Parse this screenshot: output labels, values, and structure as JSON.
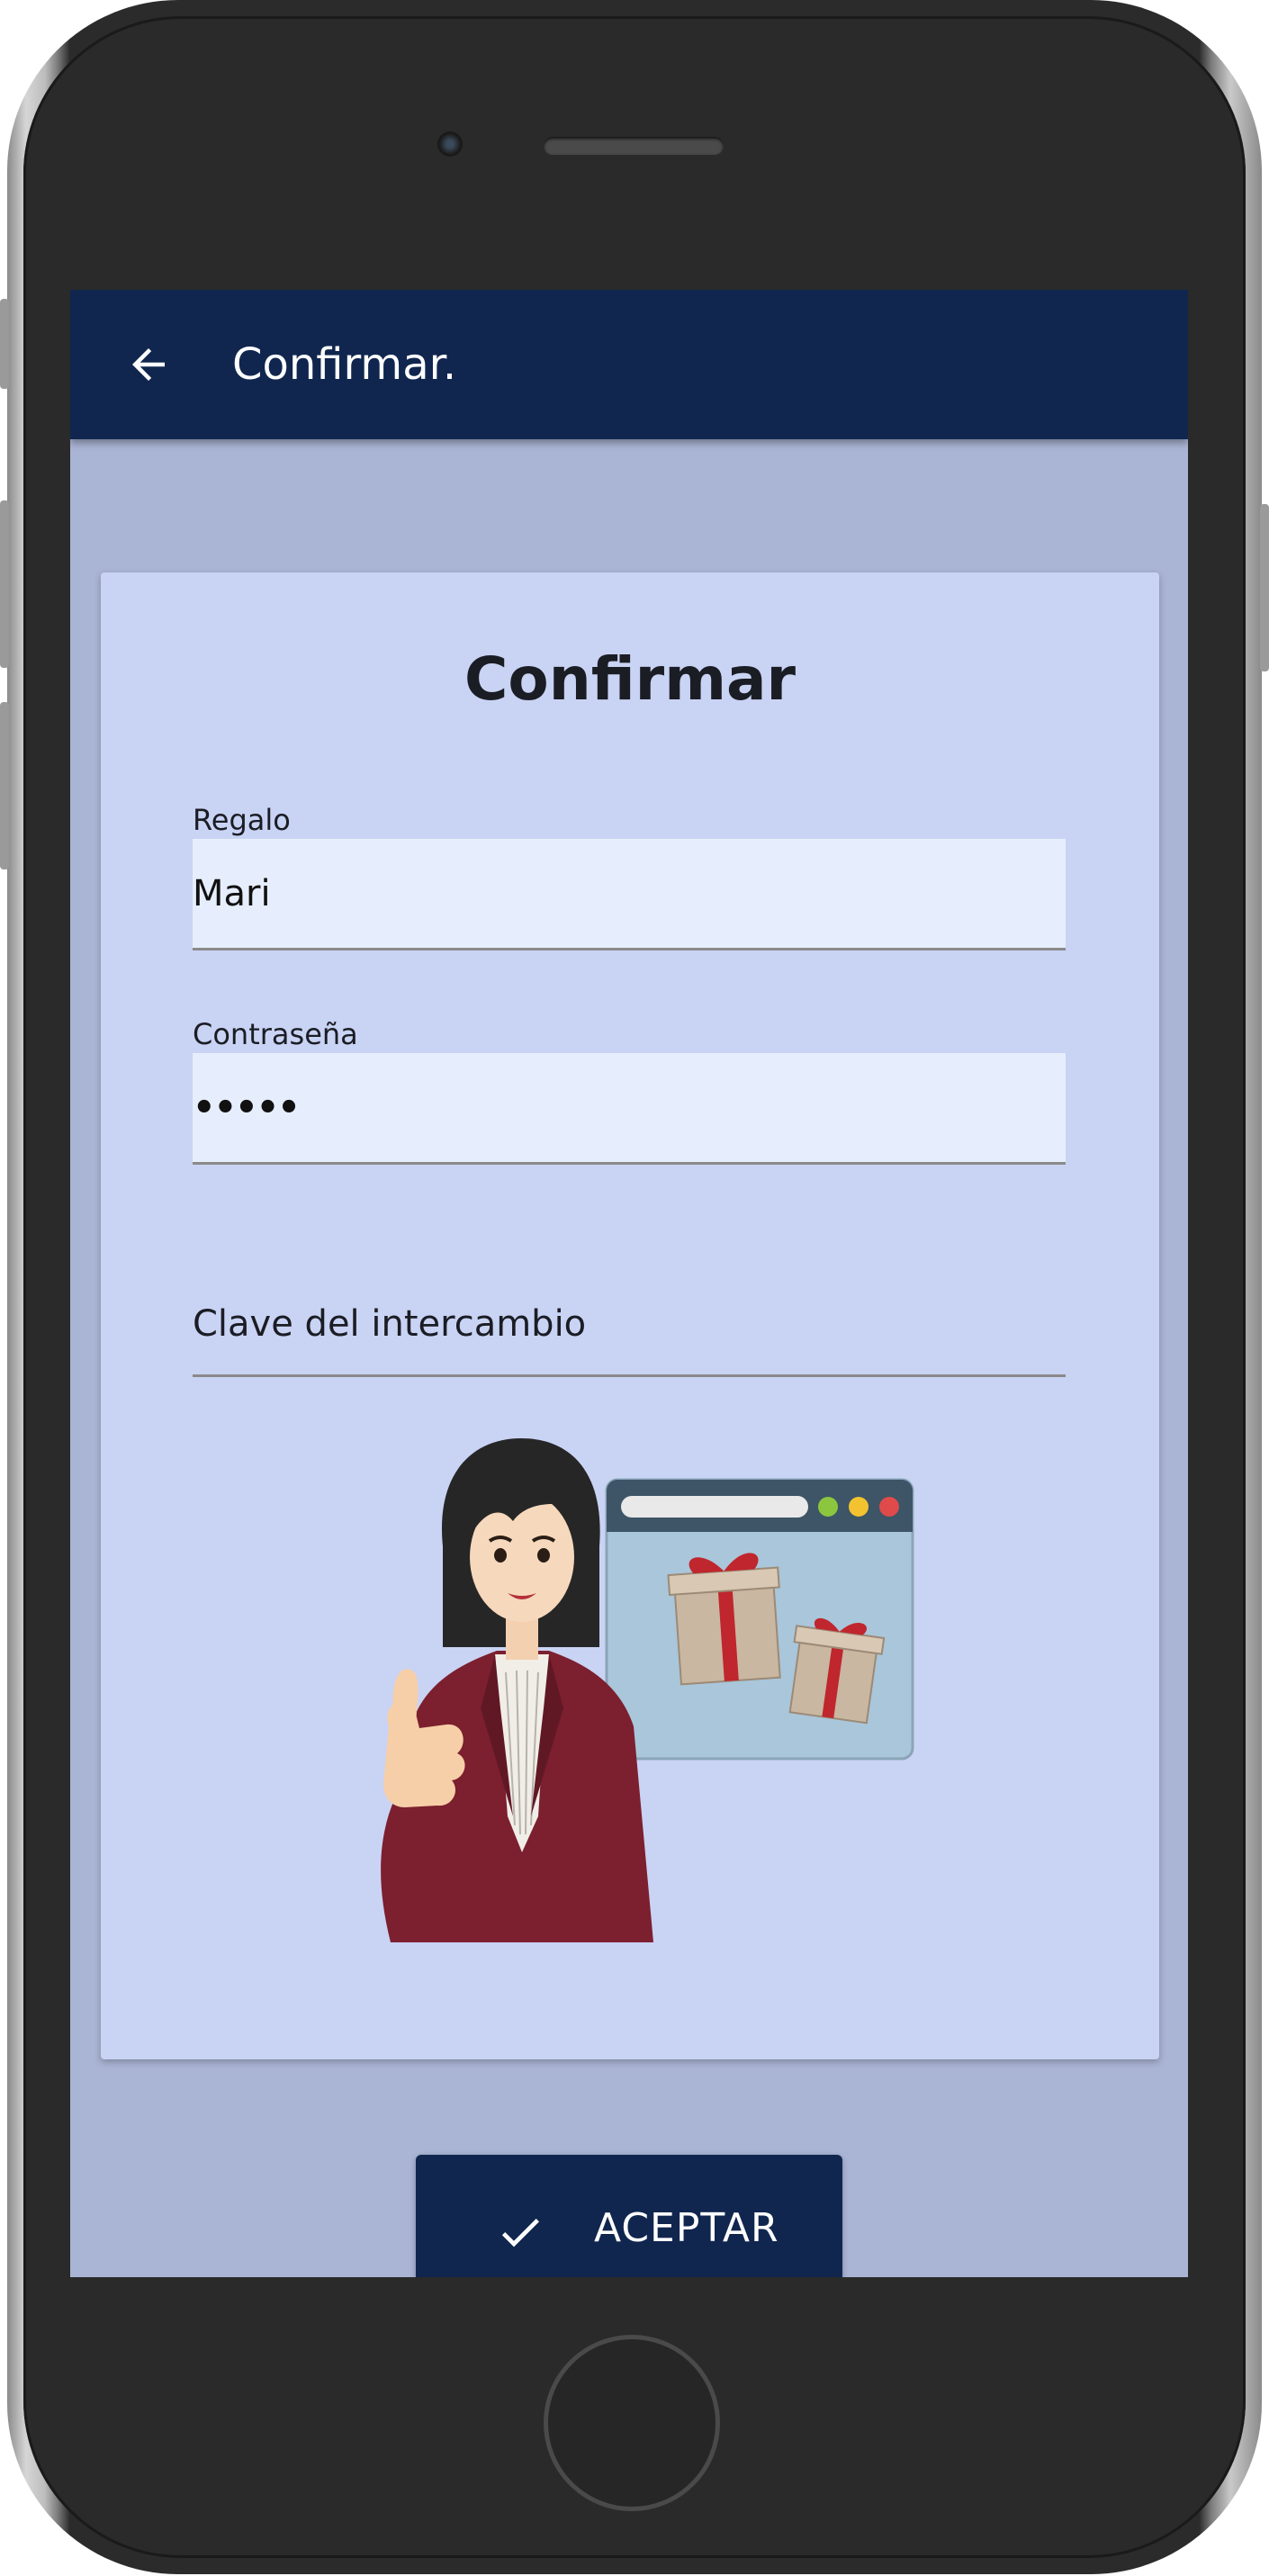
{
  "appbar": {
    "title": "Confirmar.",
    "back_icon": "arrow-left-icon"
  },
  "card": {
    "title": "Confirmar",
    "gift_field": {
      "label": "Regalo",
      "value": "Mari"
    },
    "password_field": {
      "label": "Contraseña",
      "value": "•••••"
    },
    "exchange_key_field": {
      "placeholder": "Clave del intercambio",
      "value": ""
    },
    "illustration": "woman-thumbs-up-gifts-illustration"
  },
  "accept_button": {
    "label": "ACEPTAR",
    "icon": "check-icon"
  },
  "colors": {
    "appbar": "#10264f",
    "screen_background": "#aab4d4",
    "card_background": "#c9d3f4",
    "field_background": "#e6eefd",
    "button": "#10264f"
  }
}
